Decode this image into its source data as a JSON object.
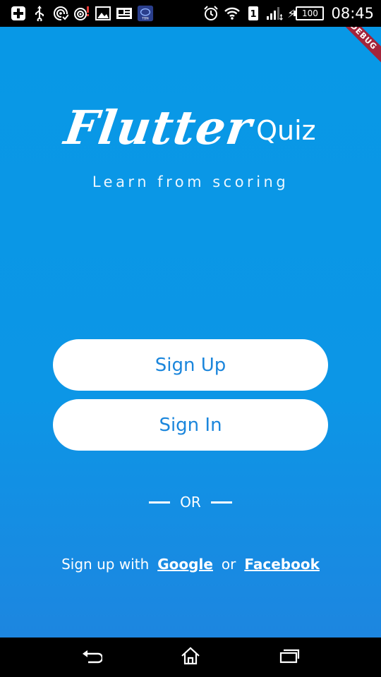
{
  "status_bar": {
    "time": "08:45",
    "battery_level": "100",
    "sim_slot": "1",
    "icons": [
      "plus-notification-icon",
      "usb-icon",
      "wifi-hotspot-icon",
      "hotspot-alert-icon",
      "image-icon",
      "news-icon",
      "app-notification-icon",
      "alarm-icon",
      "wifi-icon",
      "sim-icon",
      "signal-icon",
      "charging-icon",
      "battery-icon"
    ]
  },
  "debug_banner": "DEBUG",
  "logo": {
    "main": "Flutter",
    "sub": "Quiz"
  },
  "tagline": "Learn from scoring",
  "buttons": {
    "sign_up": "Sign Up",
    "sign_in": "Sign In"
  },
  "divider": {
    "label": "OR"
  },
  "social": {
    "prefix": "Sign up with",
    "google": "Google",
    "conjunction": "or",
    "facebook": "Facebook"
  },
  "nav_bar": {
    "icons": [
      "back-icon",
      "home-icon",
      "recent-apps-icon"
    ]
  },
  "colors": {
    "background_top": "#0898e6",
    "background_bottom": "#1d86e0",
    "button_text": "#1b86dc",
    "debug_ribbon": "#a3243b"
  }
}
